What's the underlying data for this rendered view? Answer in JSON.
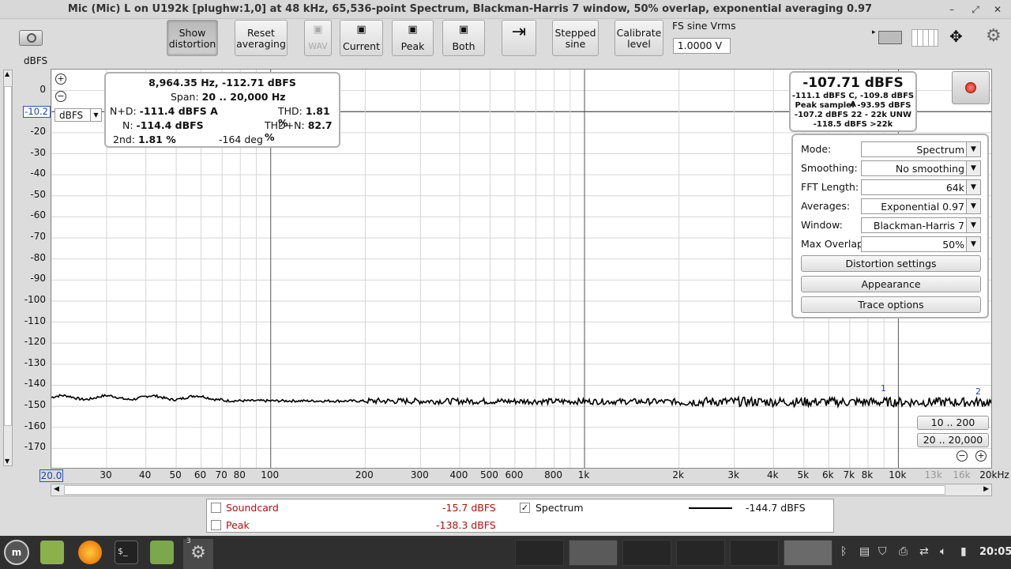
{
  "window": {
    "title": "Mic (Mic) L on U192k [plughw:1,0] at 48 kHz, 65,536-point Spectrum, Blackman-Harris 7 window, 50% overlap, exponential averaging 0.97",
    "minimize": "–",
    "restore": "⤢",
    "close": "✕"
  },
  "toolbar": {
    "show_distortion": [
      "Show",
      "distortion"
    ],
    "reset_averaging": [
      "Reset",
      "averaging"
    ],
    "wav": "WAV",
    "current": "Current",
    "peak": "Peak",
    "both": "Both",
    "stepped_sine": [
      "Stepped",
      "sine"
    ],
    "calibrate_level": [
      "Calibrate",
      "level"
    ],
    "fs_label": "FS sine Vrms",
    "fs_value": "1.0000 V"
  },
  "graph": {
    "yunit": "dBFS",
    "ref_value": "-10.2",
    "unit_select": "dBFS",
    "yticks": [
      "0",
      "-10",
      "-20",
      "-30",
      "-40",
      "-50",
      "-60",
      "-70",
      "-80",
      "-90",
      "-100",
      "-110",
      "-120",
      "-130",
      "-140",
      "-150",
      "-160",
      "-170"
    ],
    "xticks": [
      "20.0",
      "30",
      "40",
      "50",
      "60",
      "70",
      "80",
      "100",
      "200",
      "300",
      "400",
      "500",
      "600",
      "800",
      "1k",
      "2k",
      "3k",
      "4k",
      "5k",
      "6k",
      "7k",
      "8k",
      "10k",
      "13k",
      "16k",
      "20kHz"
    ],
    "marker1": "1",
    "marker2": "2"
  },
  "readout": {
    "freq_line": "8,964.35 Hz, -112.71 dBFS",
    "span_label": "Span:",
    "span_value": "20 .. 20,000 Hz",
    "nd_label": "N+D:",
    "nd_value": "-111.4 dBFS A",
    "thd_label": "THD:",
    "thd_value": "1.81 %",
    "n_label": "N:",
    "n_value": "-114.4 dBFS",
    "thdn_label": "THD+N:",
    "thdn_value": "82.7 %",
    "second_label": "2nd:",
    "second_value": "1.81 %",
    "phase": "-164 deg"
  },
  "level": {
    "main": "-107.71 dBFS",
    "line1": "-111.1 dBFS C, -109.8 dBFS A",
    "line2": "Peak sample: -93.95 dBFS",
    "line3": "-107.2 dBFS 22 - 22k UNW",
    "line4": "-118.5 dBFS >22k"
  },
  "controls": {
    "mode_label": "Mode:",
    "mode_value": "Spectrum",
    "smoothing_label": "Smoothing:",
    "smoothing_value": "No  smoothing",
    "fft_label": "FFT Length:",
    "fft_value": "64k",
    "averages_label": "Averages:",
    "averages_value": "Exponential 0.97",
    "window_label": "Window:",
    "window_value": "Blackman-Harris 7",
    "overlap_label": "Max Overlap:",
    "overlap_value": "50%",
    "distortion_settings": "Distortion settings",
    "appearance": "Appearance",
    "trace_options": "Trace options"
  },
  "range_buttons": {
    "r1": "10 .. 200",
    "r2": "20 .. 20,000"
  },
  "legend": {
    "soundcard": "Soundcard",
    "soundcard_value": "-15.7 dBFS",
    "peak": "Peak",
    "peak_value": "-138.3 dBFS",
    "spectrum": "Spectrum",
    "spectrum_value": "-144.7 dBFS",
    "spectrum_check": "✓"
  },
  "taskbar": {
    "clock": "20:05",
    "badge": "3",
    "terminal": "$_"
  },
  "colors": {
    "label_red": "#b01010",
    "trace": "#000000",
    "taskbar": "#2f2f2f"
  }
}
